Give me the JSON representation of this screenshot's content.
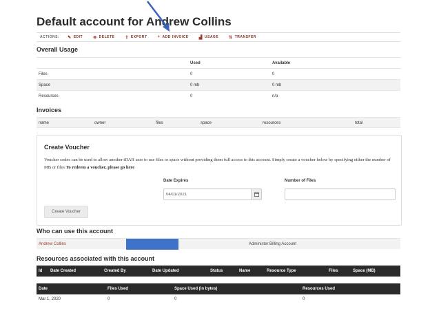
{
  "page": {
    "title": "Default account for Andrew Collins"
  },
  "actions": {
    "label": "ACTIONS:",
    "items": [
      {
        "label": "EDIT",
        "icon": "pencil-icon"
      },
      {
        "label": "DELETE",
        "icon": "delete-icon"
      },
      {
        "label": "EXPORT",
        "icon": "export-icon"
      },
      {
        "label": "ADD INVOICE",
        "icon": "plus-icon"
      },
      {
        "label": "USAGE",
        "icon": "chart-icon"
      },
      {
        "label": "TRANSFER",
        "icon": "transfer-icon"
      }
    ]
  },
  "overall_usage": {
    "heading": "Overall Usage",
    "columns": [
      "",
      "Used",
      "Available"
    ],
    "rows": [
      {
        "label": "Files",
        "used": "0",
        "available": "0"
      },
      {
        "label": "Space",
        "used": "0 mb",
        "available": "0 mb"
      },
      {
        "label": "Resources",
        "used": "0",
        "available": "n/a"
      }
    ]
  },
  "invoices": {
    "heading": "Invoices",
    "columns": [
      "name",
      "owner",
      "files",
      "space",
      "resources",
      "total"
    ]
  },
  "voucher": {
    "title": "Create Voucher",
    "description": "Voucher codes can be used to allow another tDAR user to use files or space without providing them full access to this account. Simply create a voucher below by specifying either the number of MB or files ",
    "redeem_text": "To redeem a voucher, please go here",
    "date_label": "Date Expires",
    "date_value": "04/01/2021",
    "files_label": "Number of Files",
    "files_value": "",
    "button_label": "Create Voucher"
  },
  "access": {
    "heading": "Who can use this account",
    "user": "Andrew Collins",
    "link": "Administer Billing Account"
  },
  "resources": {
    "heading": "Resources associated with this account",
    "columns": [
      "Id",
      "Date Created",
      "Created By",
      "Date Updated",
      "Status",
      "Name",
      "Resource Type",
      "Files",
      "Space (MB)"
    ]
  },
  "usage_history": {
    "columns": [
      "Date",
      "Files Used",
      "Space Used (in bytes)",
      "Resources Used"
    ],
    "rows": [
      {
        "date": "Mar 1, 2020",
        "files": "0",
        "space": "0",
        "resources": "0"
      }
    ]
  },
  "colors": {
    "accent": "#a0392b",
    "dark_header": "#2a2a2a",
    "user_bar": "#3f72c9",
    "arrow": "#3a63b8"
  }
}
